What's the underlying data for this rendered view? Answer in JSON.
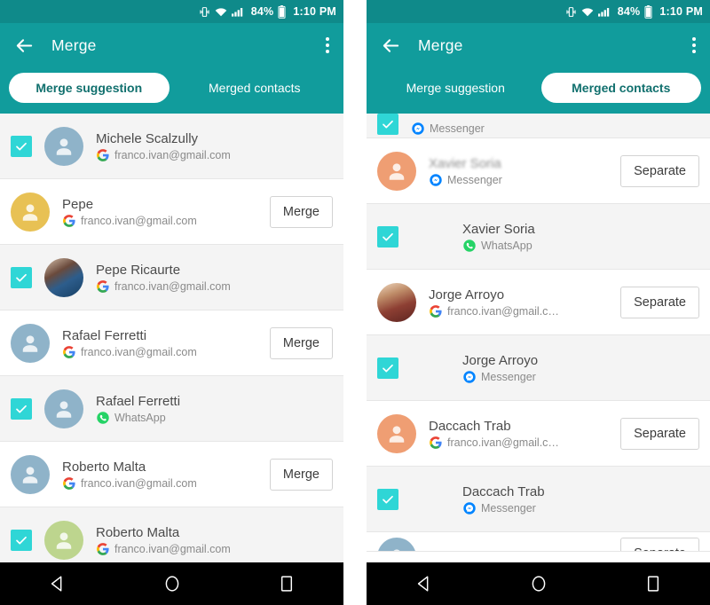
{
  "statusbar": {
    "battery_percent": "84%",
    "time": "1:10 PM",
    "icons": [
      "vibrate-icon",
      "wifi-icon",
      "signal-icon",
      "battery-icon"
    ]
  },
  "appbar": {
    "title": "Merge",
    "back_icon": "back-arrow-icon",
    "overflow_icon": "overflow-menu-icon"
  },
  "panels": [
    {
      "id": "merge-suggestion-panel",
      "tabs": [
        {
          "label": "Merge suggestion",
          "active": true
        },
        {
          "label": "Merged contacts",
          "active": false
        }
      ],
      "rows": [
        {
          "type": "full",
          "checked": true,
          "avatar": "av-blue",
          "name": "Michele Scalzully",
          "blurred": false,
          "source_icon": "google-icon",
          "source": "franco.ivan@gmail.com",
          "action": null
        },
        {
          "type": "full",
          "checked": false,
          "avatar": "av-yellow",
          "name": "Pepe",
          "blurred": false,
          "source_icon": "google-icon",
          "source": "franco.ivan@gmail.com",
          "action": "Merge"
        },
        {
          "type": "full",
          "checked": true,
          "avatar": "av-photo1",
          "name": "Pepe Ricaurte",
          "blurred": false,
          "source_icon": "google-icon",
          "source": "franco.ivan@gmail.com",
          "action": null
        },
        {
          "type": "full",
          "checked": false,
          "avatar": "av-blue",
          "name": "Rafael Ferretti",
          "blurred": false,
          "source_icon": "google-icon",
          "source": "franco.ivan@gmail.com",
          "action": "Merge"
        },
        {
          "type": "full",
          "checked": true,
          "avatar": "av-blue",
          "name": "Rafael Ferretti",
          "blurred": false,
          "source_icon": "whatsapp-icon",
          "source": "WhatsApp",
          "action": null
        },
        {
          "type": "full",
          "checked": false,
          "avatar": "av-blue",
          "name": "Roberto Malta",
          "blurred": false,
          "source_icon": "google-icon",
          "source": "franco.ivan@gmail.com",
          "action": "Merge"
        },
        {
          "type": "full",
          "checked": true,
          "avatar": "av-green",
          "name": "Roberto Malta",
          "blurred": false,
          "source_icon": "google-icon",
          "source": "franco.ivan@gmail.com",
          "action": null
        }
      ]
    },
    {
      "id": "merged-contacts-panel",
      "tabs": [
        {
          "label": "Merge suggestion",
          "active": false
        },
        {
          "label": "Merged contacts",
          "active": true
        }
      ],
      "rows": [
        {
          "type": "clip-top",
          "checked": true,
          "avatar": null,
          "name": "",
          "blurred": false,
          "source_icon": "messenger-icon",
          "source": "Messenger",
          "action": null
        },
        {
          "type": "full",
          "checked": false,
          "avatar": "av-orange",
          "name": "Xavier Soria",
          "blurred": true,
          "source_icon": "messenger-icon",
          "source": "Messenger",
          "action": "Separate"
        },
        {
          "type": "full",
          "checked": true,
          "avatar": null,
          "name": "Xavier Soria",
          "blurred": false,
          "source_icon": "whatsapp-icon",
          "source": "WhatsApp",
          "action": null
        },
        {
          "type": "full",
          "checked": false,
          "avatar": "av-photo2",
          "name": "Jorge Arroyo",
          "blurred": false,
          "source_icon": "google-icon",
          "source": "franco.ivan@gmail.c…",
          "action": "Separate"
        },
        {
          "type": "full",
          "checked": true,
          "avatar": null,
          "name": "Jorge Arroyo",
          "blurred": false,
          "source_icon": "messenger-icon",
          "source": "Messenger",
          "action": null
        },
        {
          "type": "full",
          "checked": false,
          "avatar": "av-orange",
          "name": "Daccach Trab",
          "blurred": false,
          "source_icon": "google-icon",
          "source": "franco.ivan@gmail.c…",
          "action": "Separate"
        },
        {
          "type": "full",
          "checked": true,
          "avatar": null,
          "name": "Daccach Trab",
          "blurred": false,
          "source_icon": "messenger-icon",
          "source": "Messenger",
          "action": null
        },
        {
          "type": "clip-bottom",
          "checked": false,
          "avatar": "av-blue",
          "name": "",
          "blurred": false,
          "source_icon": null,
          "source": "",
          "action": "Separate"
        }
      ]
    }
  ],
  "navbar": {
    "buttons": [
      {
        "name": "back-nav-button",
        "icon": "triangle-back-icon"
      },
      {
        "name": "home-nav-button",
        "icon": "circle-home-icon"
      },
      {
        "name": "recents-nav-button",
        "icon": "square-recents-icon"
      }
    ]
  },
  "colors": {
    "statusbar": "#0f8a8a",
    "appbar": "#119c9c",
    "checkbox": "#2fd6d6",
    "tab_active_text": "#11706e",
    "whatsapp": "#25D366",
    "messenger": "#0084FF",
    "navbar": "#000000"
  }
}
